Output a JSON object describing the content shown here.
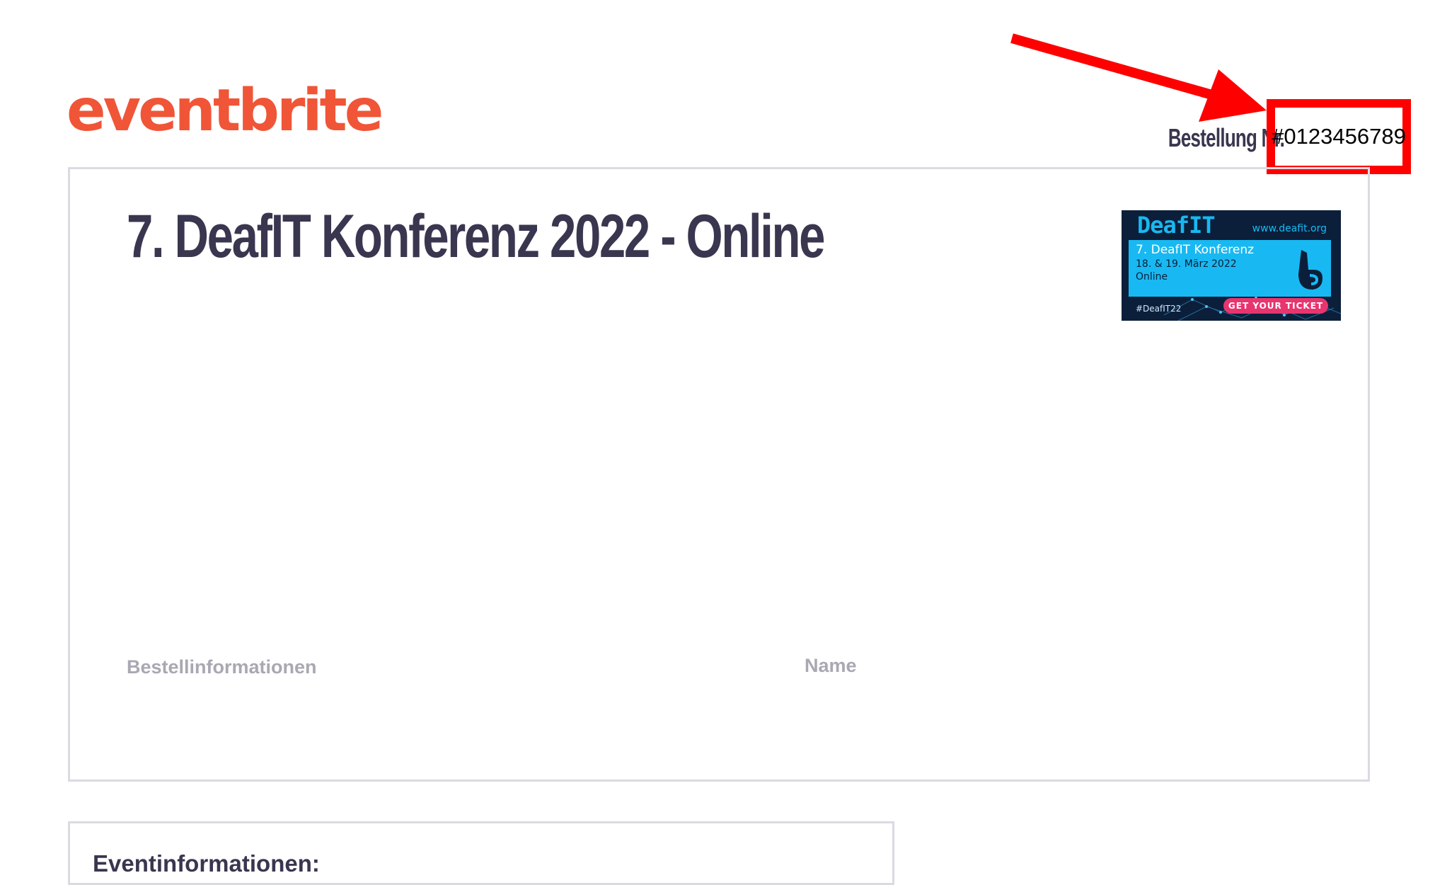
{
  "header": {
    "logo_text": "eventbrite",
    "order_label": "Bestellung Nr.",
    "order_number": "#0123456789"
  },
  "ticket": {
    "event_title": "7. DeafIT Konferenz 2022 - Online",
    "order_info_label": "Bestellinformationen",
    "name_label": "Name",
    "banner": {
      "brand": "DeafIT",
      "url": "www.deafit.org",
      "conference": "7. DeafIT Konferenz",
      "dates": "18. & 19. März 2022",
      "place": "Online",
      "hashtag": "#DeafIT22",
      "cta": "GET YOUR TICKET"
    }
  },
  "event_info": {
    "title": "Eventinformationen:"
  },
  "colors": {
    "brand": "#f05537",
    "text_dark": "#39364f",
    "text_muted": "#a9a8b3",
    "highlight": "#ff0000",
    "card_border": "#dbdae3"
  },
  "icons": {
    "annotation_arrow": "arrow-icon",
    "banner_hand": "hand-sign-icon"
  }
}
